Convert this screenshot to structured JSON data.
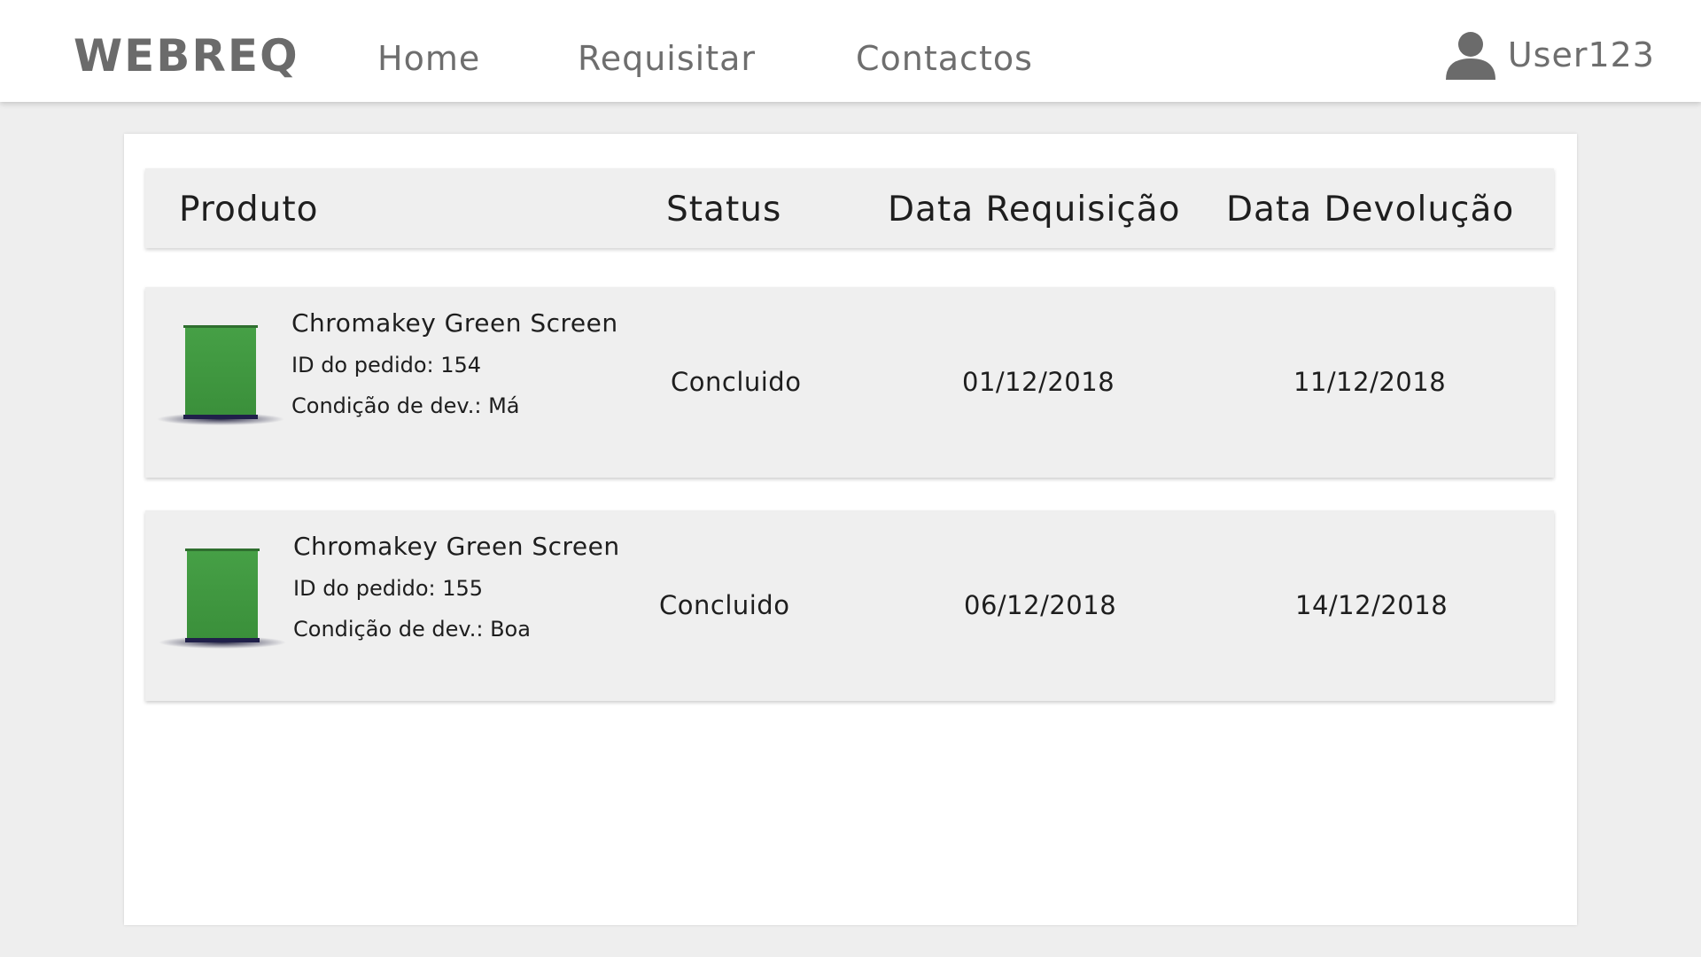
{
  "header": {
    "logo": "WEBREQ",
    "nav": [
      {
        "label": "Home"
      },
      {
        "label": "Requisitar"
      },
      {
        "label": "Contactos"
      }
    ],
    "user": {
      "name": "User123",
      "icon": "user-icon"
    }
  },
  "table": {
    "columns": [
      "Produto",
      "Status",
      "Data Requisição",
      "Data Devolução"
    ],
    "rows": [
      {
        "product": "Chromakey Green Screen",
        "order_id": "ID do pedido: 154",
        "condition": "Condição de dev.: Má",
        "status": "Concluido",
        "date_requested": "01/12/2018",
        "date_returned": "11/12/2018"
      },
      {
        "product": "Chromakey Green Screen",
        "order_id": "ID do pedido: 155",
        "condition": "Condição de dev.: Boa",
        "status": "Concluido",
        "date_requested": "06/12/2018",
        "date_returned": "14/12/2018"
      }
    ]
  },
  "colors": {
    "background": "#eeeeee",
    "topbar": "#ffffff",
    "nav_text": "#6e6e6e",
    "row_bg": "#efefef",
    "green_screen": "#3f9b3f"
  }
}
